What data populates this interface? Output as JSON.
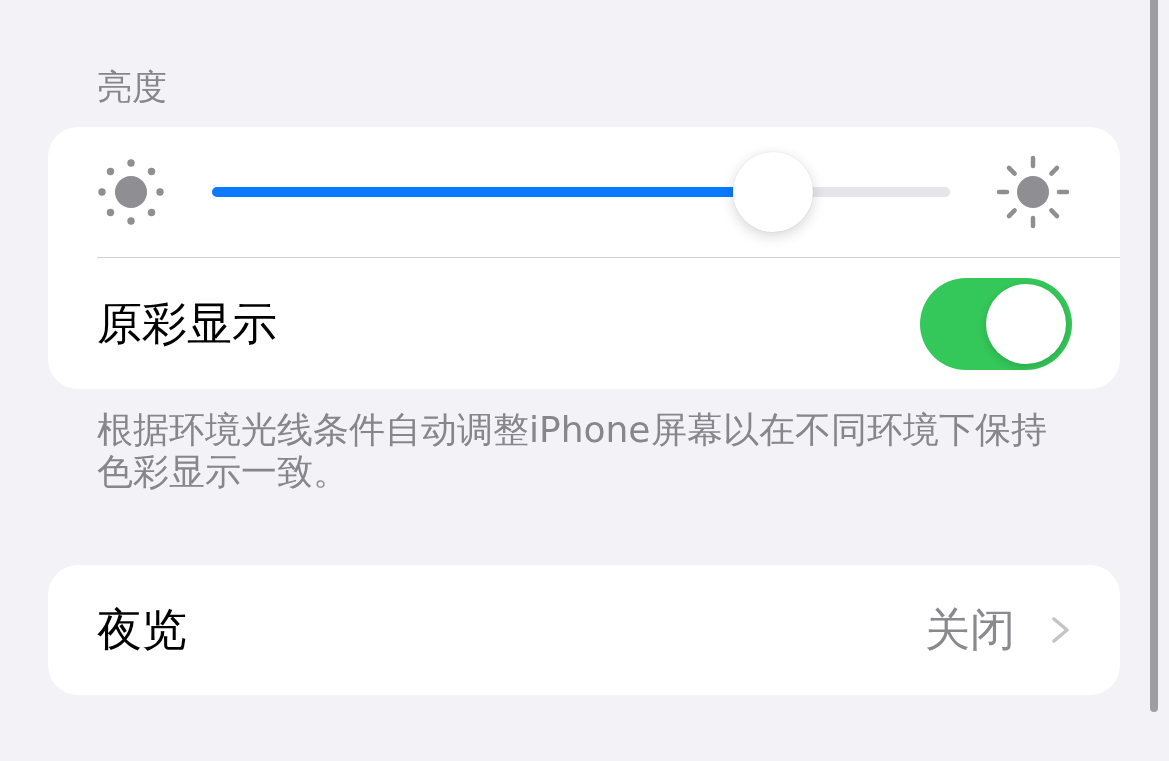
{
  "brightness": {
    "header": "亮度",
    "level": 0.76
  },
  "true_tone": {
    "label": "原彩显示",
    "on": true,
    "description": "根据环境光线条件自动调整iPhone屏幕以在不同环境下保持色彩显示一致。"
  },
  "night_shift": {
    "label": "夜览",
    "value": "关闭"
  }
}
